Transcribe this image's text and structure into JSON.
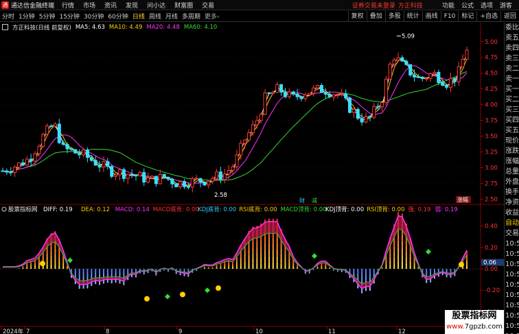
{
  "app": {
    "title": "通达信金融终端",
    "logo": "通"
  },
  "menu": [
    "行情",
    "市场",
    "资讯",
    "发现",
    "问小达",
    "财富圈",
    "交易"
  ],
  "notice": "证券交易未登录",
  "broker": "方正科技",
  "right_menu": [
    "功能",
    "公式",
    "选项",
    "游客"
  ],
  "periods": [
    {
      "label": "分时"
    },
    {
      "label": "1分钟"
    },
    {
      "label": "5分钟"
    },
    {
      "label": "15分钟"
    },
    {
      "label": "30分钟"
    },
    {
      "label": "60分钟"
    },
    {
      "label": "日线",
      "active": true
    },
    {
      "label": "周线"
    },
    {
      "label": "月线"
    },
    {
      "label": "多周期"
    },
    {
      "label": "更多"
    }
  ],
  "more_arrow": "›",
  "right_tools": [
    "复权",
    "叠加",
    "多股",
    "统计",
    "画线",
    "F10",
    "标记",
    "+自选",
    "返回"
  ],
  "main_info": {
    "title": "方正科技(日线 前复权)",
    "ma": [
      {
        "label": "MA5: 4.63",
        "color": "#ffffff"
      },
      {
        "label": "MA10: 4.49",
        "color": "#ffd000"
      },
      {
        "label": "MA20: 4.48",
        "color": "#ff33ff"
      },
      {
        "label": "MA60: 4.10",
        "color": "#33dd33"
      }
    ]
  },
  "price_axis": [
    "5.00",
    "4.75",
    "4.50",
    "4.25",
    "4.00",
    "3.75",
    "3.50",
    "3.25",
    "3.00",
    "2.75",
    "2.50"
  ],
  "annotations": {
    "high": "5.09",
    "low": "2.58",
    "events": [
      "财",
      "减",
      "涨幅"
    ]
  },
  "sidebar": [
    "委比",
    "卖五",
    "卖四",
    "卖三",
    "卖二",
    "卖一",
    "买一",
    "买二",
    "买三",
    "买四",
    "买五",
    "现价",
    "涨跌",
    "涨幅",
    "总量",
    "外盘",
    "换手",
    "净资",
    "收益",
    "自动",
    "交易",
    "10:50",
    "10:50",
    "10:50",
    "10:50",
    "10:50",
    "10:50",
    "10:50",
    "10:50",
    "10:50",
    "10:50"
  ],
  "sub_info": {
    "title": "股票指标网",
    "items": [
      {
        "label": "DIFF: 0.19",
        "color": "#ffffff"
      },
      {
        "label": "DEA: 0.12",
        "color": "#ffd000"
      },
      {
        "label": "MACD: 0.14",
        "color": "#ff33ff"
      },
      {
        "label": "MACD底背: 0.00",
        "color": "#ff3333"
      },
      {
        "label": "KDJ底背: 0.00",
        "color": "#33ccff"
      },
      {
        "label": "RSI底背: 0.00",
        "color": "#ffd000"
      },
      {
        "label": "MACD顶背: 0.00",
        "color": "#33dd33"
      },
      {
        "label": "KDJ顶背: 0.00",
        "color": "#ffffff"
      },
      {
        "label": "RSI顶背: 0.00",
        "color": "#ffd000"
      },
      {
        "label": "强: 0.19",
        "color": "#ff3333"
      },
      {
        "label": "弱: 0.19",
        "color": "#ff33ff"
      }
    ]
  },
  "sub_axis": [
    "0.40",
    "0.20",
    "0.00",
    "-0.20",
    "-0.40"
  ],
  "sub_current": "0.06",
  "date_axis": [
    "2024年",
    "7",
    "8",
    "9",
    "10",
    "11",
    "12"
  ],
  "watermark": {
    "line1": "股票指标网",
    "line2a": "www.",
    "line2b": "7gpzb.com"
  }
}
